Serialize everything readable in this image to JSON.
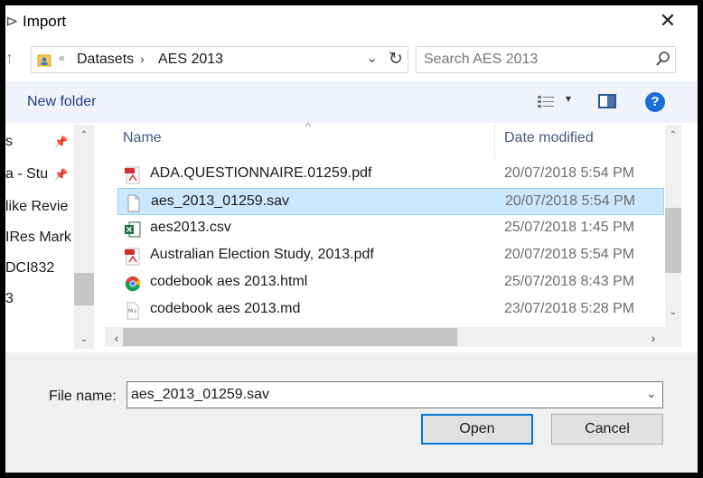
{
  "window": {
    "title": "Import"
  },
  "address": {
    "overflow": "«",
    "segments": [
      "Datasets",
      "AES 2013"
    ]
  },
  "search": {
    "placeholder": "Search AES 2013"
  },
  "toolbar": {
    "new_folder": "New folder",
    "help": "?"
  },
  "sidebar": {
    "items": [
      {
        "label": "s"
      },
      {
        "label": "a - Stu"
      },
      {
        "label": "like Revie"
      },
      {
        "label": "IRes Mark"
      },
      {
        "label": "DCI832"
      },
      {
        "label": "3"
      }
    ]
  },
  "columns": {
    "name": "Name",
    "date_modified": "Date modified"
  },
  "files": [
    {
      "name": "ADA.QUESTIONNAIRE.01259.pdf",
      "date": "20/07/2018 5:54 PM",
      "icon": "pdf-icon"
    },
    {
      "name": "aes_2013_01259.sav",
      "date": "20/07/2018 5:54 PM",
      "icon": "file-icon",
      "selected": true
    },
    {
      "name": "aes2013.csv",
      "date": "25/07/2018 1:45 PM",
      "icon": "excel-icon"
    },
    {
      "name": "Australian Election Study, 2013.pdf",
      "date": "20/07/2018 5:54 PM",
      "icon": "pdf-icon"
    },
    {
      "name": "codebook aes 2013.html",
      "date": "25/07/2018 8:43 PM",
      "icon": "chrome-icon"
    },
    {
      "name": "codebook aes 2013.md",
      "date": "23/07/2018 5:28 PM",
      "icon": "markdown-icon"
    }
  ],
  "footer": {
    "file_name_label": "File name:",
    "file_name_value": "aes_2013_01259.sav",
    "open_label": "Open",
    "cancel_label": "Cancel"
  },
  "colors": {
    "accent": "#0078d7",
    "selection": "#cce8ff",
    "toolbar_bg": "#f0f3f9"
  }
}
